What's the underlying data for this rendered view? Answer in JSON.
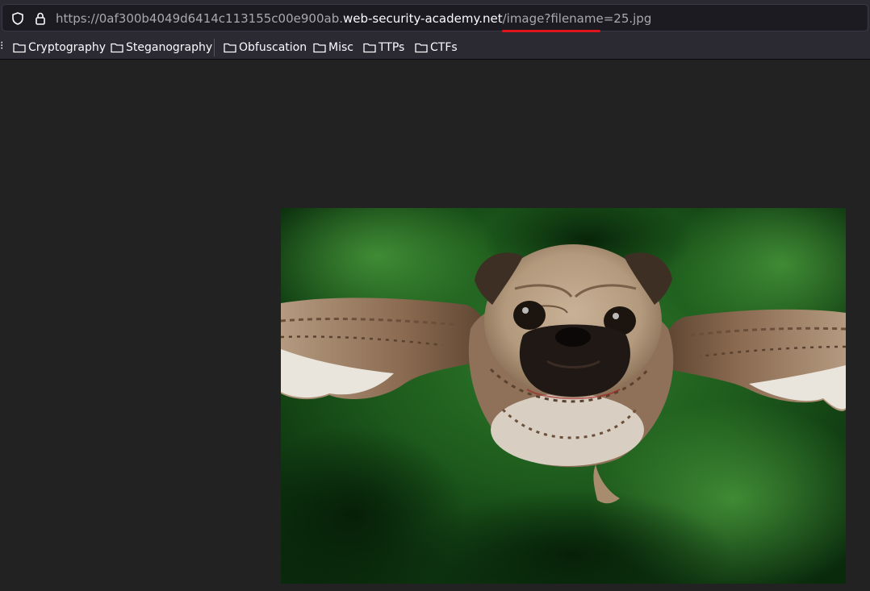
{
  "browser": {
    "url": {
      "prefix": "https://0af300b4049d6414c113155c00e900ab.",
      "host": "web-security-academy.net",
      "path": "/image?filename=25.jpg"
    },
    "icons": [
      "shield-icon",
      "lock-icon"
    ]
  },
  "bookmarks": {
    "overflow": "⁝",
    "items": [
      {
        "label": "Cryptography",
        "icon": "folder-icon"
      },
      {
        "label": "Steganography",
        "icon": "folder-icon"
      },
      {
        "label": "Obfuscation",
        "icon": "folder-icon"
      },
      {
        "label": "Misc",
        "icon": "folder-icon"
      },
      {
        "label": "TTPs",
        "icon": "folder-icon"
      },
      {
        "label": "CTFs",
        "icon": "folder-icon"
      }
    ]
  },
  "annotation": {
    "color": "#e0141c"
  },
  "content": {
    "image_subject": "pug with owl wings flying against a green background"
  }
}
